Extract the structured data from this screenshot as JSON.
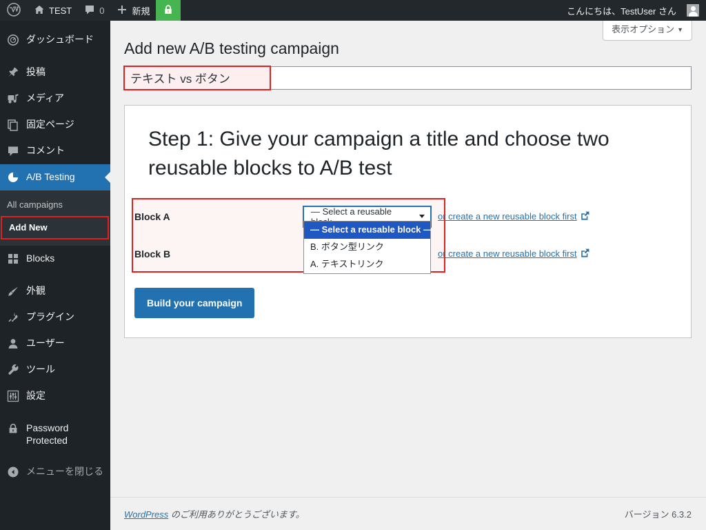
{
  "adminbar": {
    "wp_logo_icon": "wordpress-logo-icon",
    "site_name": "TEST",
    "site_icon": "home-icon",
    "comments_icon": "comment-bubble-icon",
    "comments_count": "0",
    "new_icon": "plus-icon",
    "new_label": "新規",
    "lock_icon": "padlock-icon",
    "howdy": "こんにちは、TestUser さん",
    "avatar_icon": "user-avatar-icon"
  },
  "sidebar": {
    "items": [
      {
        "label": "ダッシュボード",
        "icon": "dashboard-icon",
        "name": "dashboard"
      },
      {
        "label": "投稿",
        "icon": "pin-icon",
        "name": "posts"
      },
      {
        "label": "メディア",
        "icon": "media-icon",
        "name": "media"
      },
      {
        "label": "固定ページ",
        "icon": "pages-icon",
        "name": "pages"
      },
      {
        "label": "コメント",
        "icon": "comment-icon",
        "name": "comments"
      },
      {
        "label": "A/B Testing",
        "icon": "chart-pie-icon",
        "name": "ab-testing"
      },
      {
        "label": "Blocks",
        "icon": "blocks-grid-icon",
        "name": "blocks"
      },
      {
        "label": "外観",
        "icon": "appearance-brush-icon",
        "name": "appearance"
      },
      {
        "label": "プラグイン",
        "icon": "plugin-plug-icon",
        "name": "plugins"
      },
      {
        "label": "ユーザー",
        "icon": "user-icon",
        "name": "users"
      },
      {
        "label": "ツール",
        "icon": "wrench-icon",
        "name": "tools"
      },
      {
        "label": "設定",
        "icon": "sliders-icon",
        "name": "settings"
      },
      {
        "label": "Password Protected",
        "icon": "lock-icon",
        "name": "password-protected"
      },
      {
        "label": "メニューを閉じる",
        "icon": "collapse-arrow-icon",
        "name": "collapse-menu"
      }
    ],
    "submenu": {
      "all_campaigns": "All campaigns",
      "add_new": "Add New"
    },
    "current_color": "#2271b1",
    "highlight_color": "#e02020"
  },
  "screen_meta": {
    "show_settings_label": "表示オプション",
    "caret": "▼"
  },
  "main": {
    "page_title": "Add new A/B testing campaign",
    "campaign_title_value": "テキスト vs ボタン",
    "step_heading": "Step 1: Give your campaign a title and choose two reusable blocks to A/B test",
    "block_a_label": "Block A",
    "block_b_label": "Block B",
    "select_placeholder": "— Select a reusable block —",
    "select_caret_icon": "chevron-down-icon",
    "create_link_label": "or create a new reusable block first",
    "external_link_icon": "external-link-icon",
    "dropdown_options": [
      "— Select a reusable block —",
      "B. ボタン型リンク",
      "A. テキストリンク"
    ],
    "dropdown_selected_index": 0,
    "build_button_label": "Build your campaign",
    "accent_color": "#2271b1",
    "highlight_color": "#e02020"
  },
  "footer": {
    "thanks_link": "WordPress",
    "thanks_text": " のご利用ありがとうございます。",
    "version": "バージョン 6.3.2"
  }
}
